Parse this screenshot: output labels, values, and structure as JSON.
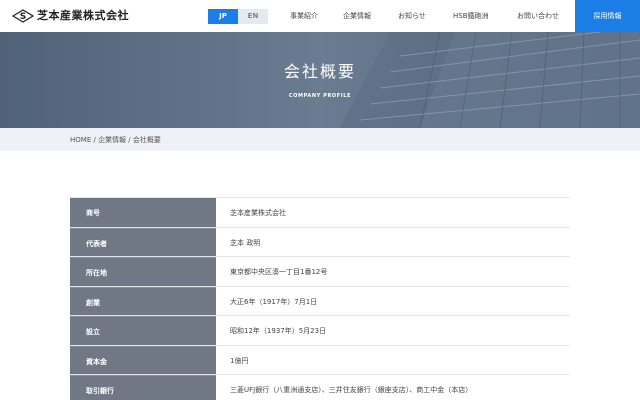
{
  "header": {
    "logo_text": "芝本産業株式会社",
    "lang": [
      "JP",
      "EN"
    ],
    "nav": [
      "事業紹介",
      "企業情報",
      "お知らせ",
      "HSB鐵砲洲",
      "お問い合わせ"
    ],
    "recruit_label": "採用情報"
  },
  "hero": {
    "title": "会社概要",
    "subtitle": "COMPANY PROFILE"
  },
  "breadcrumb": [
    "HOME",
    "企業情報",
    "会社概要"
  ],
  "breadcrumb_sep": " / ",
  "profile": [
    {
      "label": "商号",
      "value": "芝本産業株式会社"
    },
    {
      "label": "代表者",
      "value": "芝本 政明"
    },
    {
      "label": "所在地",
      "value": "東京都中央区湊一丁目1番12号"
    },
    {
      "label": "創業",
      "value": "大正6年（1917年）7月1日"
    },
    {
      "label": "設立",
      "value": "昭和12年（1937年）5月23日"
    },
    {
      "label": "資本金",
      "value": "1億円"
    },
    {
      "label": "取引銀行",
      "value": "三菱UFJ銀行（八重洲通支店）、三井住友銀行（銀座支店）、商工中金（本店）"
    }
  ],
  "colors": {
    "accent": "#1a7ee6",
    "table_header": "#6f7884",
    "breadcrumb_bg": "#eef1f5"
  }
}
